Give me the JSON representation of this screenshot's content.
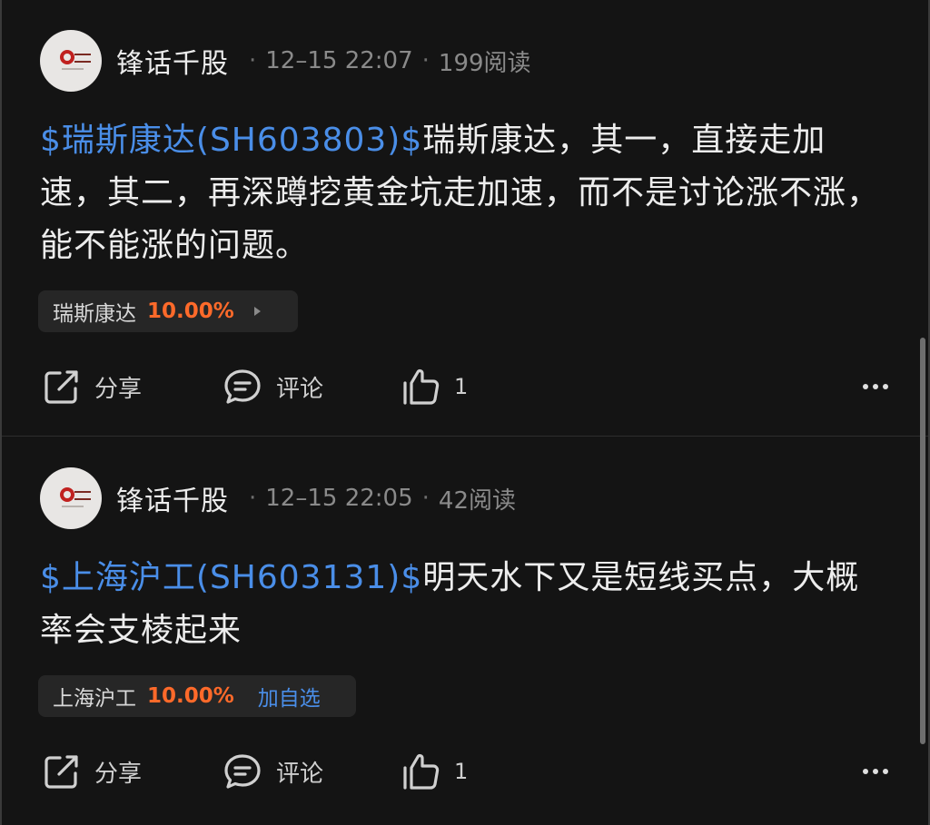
{
  "posts": [
    {
      "author": "锋话千股",
      "timestamp": "12–15 22:07",
      "reads": "199阅读",
      "ticker_link": "$瑞斯康达(SH603803)$",
      "text": "瑞斯康达，其一，直接走加速，其二，再深蹲挖黄金坑走加速，而不是讨论涨不涨，能不能涨的问题。",
      "stock_chip": {
        "name": "瑞斯康达",
        "change": "10.00%",
        "add_label": ""
      },
      "actions": {
        "share": "分享",
        "comment": "评论",
        "likes": "1"
      }
    },
    {
      "author": "锋话千股",
      "timestamp": "12–15 22:05",
      "reads": "42阅读",
      "ticker_link": "$上海沪工(SH603131)$",
      "text": "明天水下又是短线买点，大概率会支棱起来",
      "stock_chip": {
        "name": "上海沪工",
        "change": "10.00%",
        "add_label": "加自选"
      },
      "actions": {
        "share": "分享",
        "comment": "评论",
        "likes": "1"
      }
    }
  ],
  "colors": {
    "background": "#141414",
    "link": "#4a8ee8",
    "up": "#ff6a2a",
    "chip": "#262626"
  },
  "icons": [
    "share-icon",
    "comment-icon",
    "like-icon",
    "more-icon",
    "chevron-right-icon"
  ]
}
